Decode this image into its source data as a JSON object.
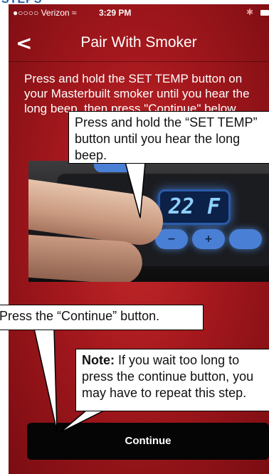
{
  "header_partial": "STEPS",
  "status_bar": {
    "carrier": "●○○○○ Verizon ≈",
    "time": "3:29 PM",
    "bluetooth": "bluetooth-icon",
    "battery": "battery-icon"
  },
  "nav": {
    "back_icon": "chevron-left-icon",
    "back_glyph": "<",
    "title": "Pair With Smoker"
  },
  "instruction": "Press and hold the SET TEMP button on your Masterbuilt smoker until you hear the long beep, then press \"Continue\" below.",
  "photo": {
    "display_text": "22 F",
    "minus": "−",
    "plus": "+"
  },
  "continue_label": "Continue",
  "callouts": {
    "hold_line1": "Press and hold the “SET TEMP”",
    "hold_line2": "button until you hear the long",
    "hold_line3": "beep.",
    "press_continue": "Press the “Continue” button.",
    "note_label": "Note:",
    "note_line1": " If you wait too long to",
    "note_line2": "press the continue button, you",
    "note_line3": "may have to repeat this step."
  },
  "colors": {
    "background_red": "#a4181d",
    "button_black": "#050505",
    "accent_blue": "#1d5fa8",
    "display_blue": "#4a7fd6"
  }
}
